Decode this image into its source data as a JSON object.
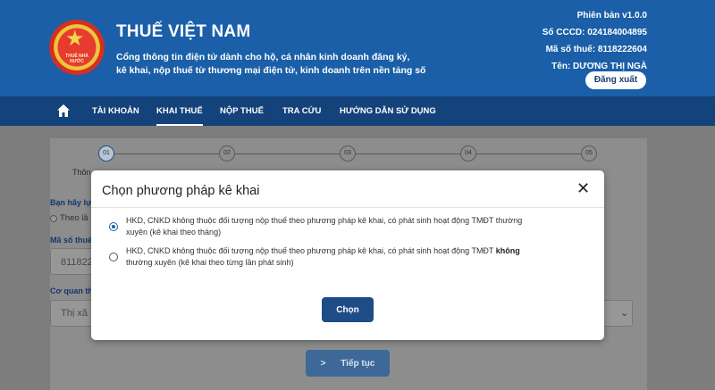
{
  "header": {
    "logo_text": "THUẾ NHÀ NƯỚC",
    "title": "THUẾ VIỆT NAM",
    "subtitle_line1": "Cổng thông tin điện tử dành cho hộ, cá nhân kinh doanh đăng ký,",
    "subtitle_line2": "kê khai, nộp thuế từ thương mại điện tử, kinh doanh trên nền tảng số",
    "version": "Phiên bản v1.0.0",
    "cccd": "Số CCCD: 024184004895",
    "tax_code": "Mã số thuế: 8118222604",
    "name": "Tên: DƯƠNG THỊ NGÀ",
    "logout_label": "Đăng xuất"
  },
  "nav": {
    "home_icon": "home-icon",
    "items": [
      "TÀI KHOẢN",
      "KHAI THUẾ",
      "NỘP THUẾ",
      "TRA CỨU",
      "HƯỚNG DẪN SỬ DỤNG"
    ],
    "active": "KHAI THUẾ"
  },
  "background": {
    "steps": [
      "01",
      "02",
      "03",
      "04",
      "05"
    ],
    "step1_caption": "Thôn",
    "label_choose": "Bạn hãy lự",
    "radio_text": "Theo lầ",
    "label_tax_code": "Mã số thuế",
    "tax_code_value": "811822",
    "label_agency": "Cơ quan th",
    "agency_value": "Thị xã",
    "next_label": "Tiếp tục"
  },
  "modal": {
    "title": "Chọn phương pháp kê khai",
    "close_icon": "close-icon",
    "option1_line1": "HKD, CNKD không thuộc đối tượng nộp thuế theo phương pháp kê khai, có phát sinh hoạt động TMĐT thường",
    "option1_line2": "xuyên (kê khai theo tháng)",
    "option2_line1_a": "HKD, CNKD không thuộc đối tượng nộp thuế theo phương pháp kê khai, có phát sinh hoạt động TMĐT ",
    "option2_line1_b": "không",
    "option2_line2": "thường xuyên (kê khai theo từng lần phát sinh)",
    "selected_option": 1,
    "choose_label": "Chọn"
  },
  "colors": {
    "header_blue": "#1a5fa8",
    "nav_blue": "#14427a",
    "button_blue": "#1d4c86"
  }
}
